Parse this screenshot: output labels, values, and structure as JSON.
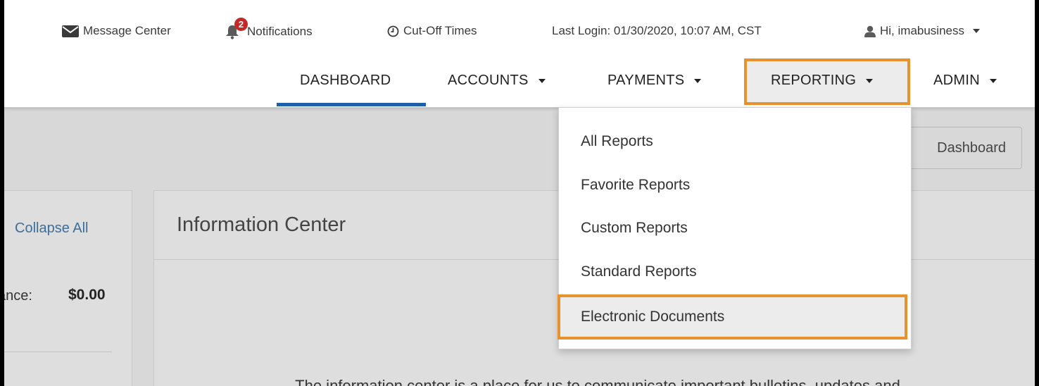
{
  "topbar": {
    "message_center": "Message Center",
    "notifications": "Notifications",
    "notifications_count": "2",
    "cutoff_times": "Cut-Off Times",
    "last_login": "Last Login: 01/30/2020, 10:07 AM, CST",
    "user_greeting": "Hi, imabusiness"
  },
  "nav": {
    "items": [
      {
        "label": "DASHBOARD",
        "active": true
      },
      {
        "label": "ACCOUNTS"
      },
      {
        "label": "PAYMENTS"
      },
      {
        "label": "REPORTING",
        "highlighted": true
      },
      {
        "label": "ADMIN"
      }
    ]
  },
  "reporting_menu": {
    "items": [
      {
        "label": "All Reports"
      },
      {
        "label": "Favorite Reports"
      },
      {
        "label": "Custom Reports"
      },
      {
        "label": "Standard Reports"
      },
      {
        "label": "Electronic Documents",
        "highlighted": true
      }
    ]
  },
  "dashboard_button": "Dashboard",
  "left_panel": {
    "collapse_all": "Collapse All",
    "balance_label": "ance:",
    "balance_value": "$0.00"
  },
  "info_center": {
    "title": "Information Center",
    "text": "The information center is a place for us to communicate important bulletins, updates and"
  },
  "colors": {
    "highlight_border": "#e8912d",
    "active_underline": "#1f5ea8",
    "link": "#3d6e99",
    "badge": "#c62828"
  }
}
